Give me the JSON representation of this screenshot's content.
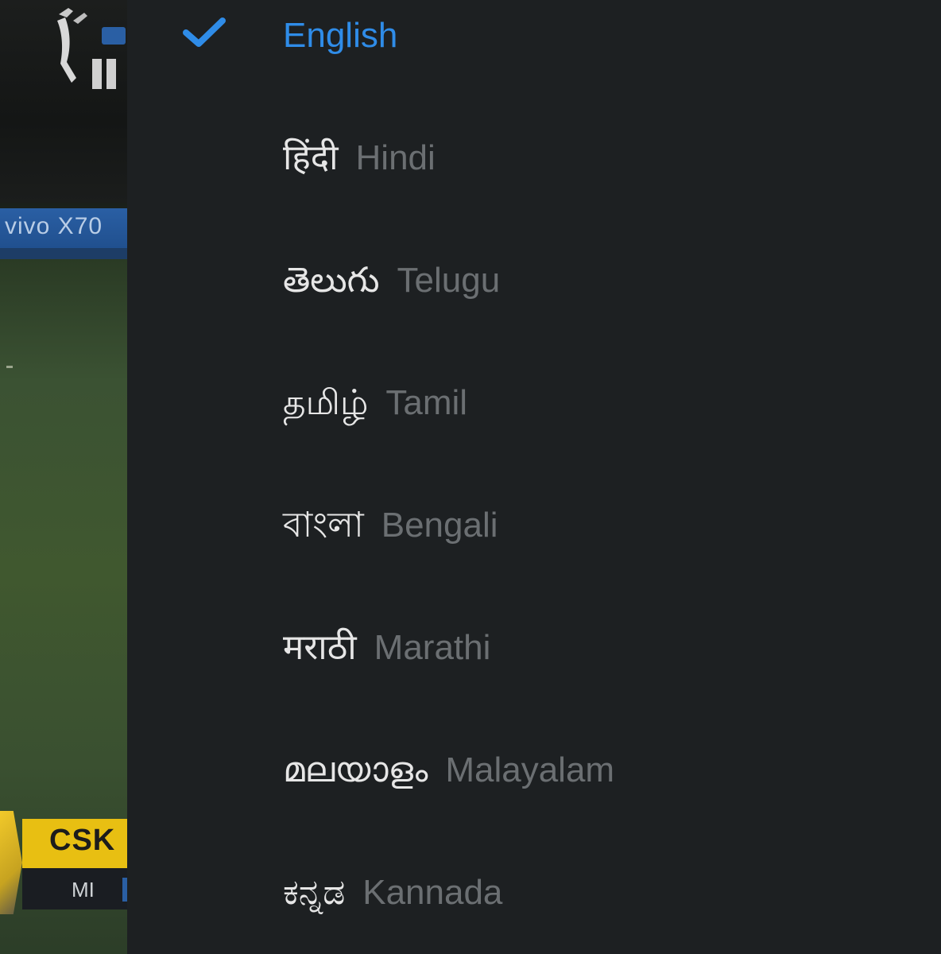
{
  "background": {
    "banner_text": "vivo X70",
    "scoreboard": {
      "team1": "CSK",
      "team2": "MI"
    }
  },
  "language_menu": {
    "accent_color": "#2f8ce8",
    "items": [
      {
        "native": "English",
        "english": "",
        "selected": true,
        "icon": "checkmark-icon"
      },
      {
        "native": "हिंदी",
        "english": "Hindi",
        "selected": false
      },
      {
        "native": "తెలుగు",
        "english": "Telugu",
        "selected": false
      },
      {
        "native": "தமிழ்",
        "english": "Tamil",
        "selected": false
      },
      {
        "native": "বাংলা",
        "english": "Bengali",
        "selected": false
      },
      {
        "native": "मराठी",
        "english": "Marathi",
        "selected": false
      },
      {
        "native": "മലയാളം",
        "english": "Malayalam",
        "selected": false
      },
      {
        "native": "ಕನ್ನಡ",
        "english": "Kannada",
        "selected": false
      }
    ]
  }
}
